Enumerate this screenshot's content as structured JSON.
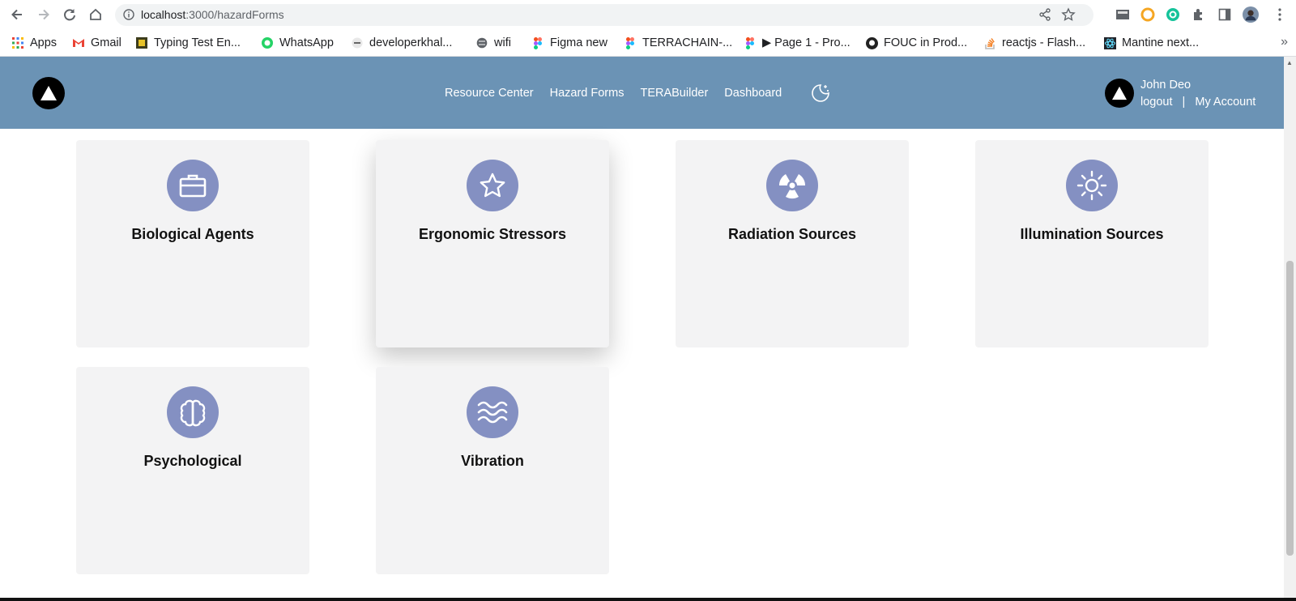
{
  "browser": {
    "url_host": "localhost",
    "url_path": ":3000/hazardForms",
    "bookmarks": [
      {
        "label": "Apps",
        "icon": "apps-grid-icon"
      },
      {
        "label": "Gmail",
        "icon": "gmail-icon"
      },
      {
        "label": "Typing Test En...",
        "icon": "typing-test-icon"
      },
      {
        "label": "WhatsApp",
        "icon": "whatsapp-icon"
      },
      {
        "label": "developerkhal...",
        "icon": "dev-icon"
      },
      {
        "label": "wifi",
        "icon": "globe-icon"
      },
      {
        "label": "Figma new",
        "icon": "figma-icon"
      },
      {
        "label": "TERRACHAIN-...",
        "icon": "figma-icon"
      },
      {
        "label": "▶ Page 1 - Pro...",
        "icon": "figma-icon"
      },
      {
        "label": "FOUC in Prod...",
        "icon": "github-icon"
      },
      {
        "label": "reactjs - Flash...",
        "icon": "stackoverflow-icon"
      },
      {
        "label": "Mantine next...",
        "icon": "react-icon"
      }
    ],
    "more": "»"
  },
  "header": {
    "nav": [
      {
        "label": "Resource Center"
      },
      {
        "label": "Hazard Forms"
      },
      {
        "label": "TERABuilder"
      },
      {
        "label": "Dashboard"
      }
    ],
    "user_name": "John Deo",
    "logout": "logout",
    "separator": "|",
    "account": "My Account",
    "bg_color": "#6b93b5"
  },
  "cards": [
    {
      "title": "Biological Agents",
      "icon": "briefcase-icon"
    },
    {
      "title": "Ergonomic Stressors",
      "icon": "star-icon"
    },
    {
      "title": "Radiation Sources",
      "icon": "radiation-icon"
    },
    {
      "title": "Illumination Sources",
      "icon": "sun-icon"
    },
    {
      "title": "Psychological",
      "icon": "brain-icon"
    },
    {
      "title": "Vibration",
      "icon": "waves-icon"
    }
  ],
  "accent_color": "#8490c2"
}
